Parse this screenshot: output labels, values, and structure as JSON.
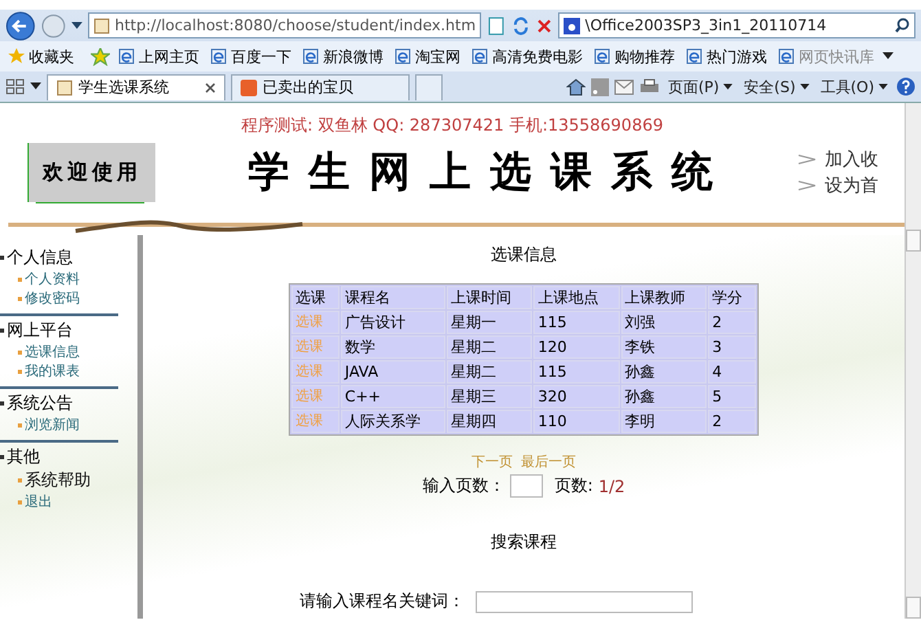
{
  "browser": {
    "address": "http://localhost:8080/choose/student/index.htm",
    "search": "\\Office2003SP3_3in1_20110714",
    "favorites_label": "收藏夹",
    "favorites": [
      "上网主页",
      "百度一下",
      "新浪微博",
      "淘宝网",
      "高清免费电影",
      "购物推荐",
      "热门游戏",
      "网页快讯库"
    ],
    "tabs": [
      {
        "label": "学生选课系统",
        "selected": true
      },
      {
        "label": "已卖出的宝贝",
        "selected": false
      }
    ],
    "tools": [
      "页面(P)",
      "安全(S)",
      "工具(O)"
    ]
  },
  "header": {
    "tester": "程序测试: 双鱼林 QQ: 287307421 手机:13558690869",
    "welcome": "欢迎使用",
    "title": "学生网上选课系统",
    "links": [
      "加入收",
      "设为首"
    ]
  },
  "sidebar": [
    {
      "title": "个人信息",
      "items": [
        {
          "label": "个人资料",
          "kind": "link"
        },
        {
          "label": "修改密码",
          "kind": "link"
        }
      ]
    },
    {
      "title": "网上平台",
      "items": [
        {
          "label": "选课信息",
          "kind": "link"
        },
        {
          "label": "我的课表",
          "kind": "link"
        }
      ]
    },
    {
      "title": "系统公告",
      "items": [
        {
          "label": "浏览新闻",
          "kind": "link"
        }
      ]
    },
    {
      "title": "其他",
      "items": [
        {
          "label": "系统帮助",
          "kind": "plain"
        },
        {
          "label": "退出",
          "kind": "link"
        }
      ]
    }
  ],
  "courses": {
    "heading": "选课信息",
    "columns": [
      "选课",
      "课程名",
      "上课时间",
      "上课地点",
      "上课教师",
      "学分"
    ],
    "rows": [
      [
        "选课",
        "广告设计",
        "星期一",
        "115",
        "刘强",
        "2"
      ],
      [
        "选课",
        "数学",
        "星期二",
        "120",
        "李铁",
        "3"
      ],
      [
        "选课",
        "JAVA",
        "星期二",
        "115",
        "孙鑫",
        "4"
      ],
      [
        "选课",
        "C++",
        "星期三",
        "320",
        "孙鑫",
        "5"
      ],
      [
        "选课",
        "人际关系学",
        "星期四",
        "110",
        "李明",
        "2"
      ]
    ],
    "pager_links": [
      "下一页",
      "最后一页"
    ],
    "page_input_label": "输入页数：",
    "page_count_label": "页数:",
    "page_count": "1/2"
  },
  "search": {
    "heading": "搜索课程",
    "label": "请输入课程名关键词："
  }
}
